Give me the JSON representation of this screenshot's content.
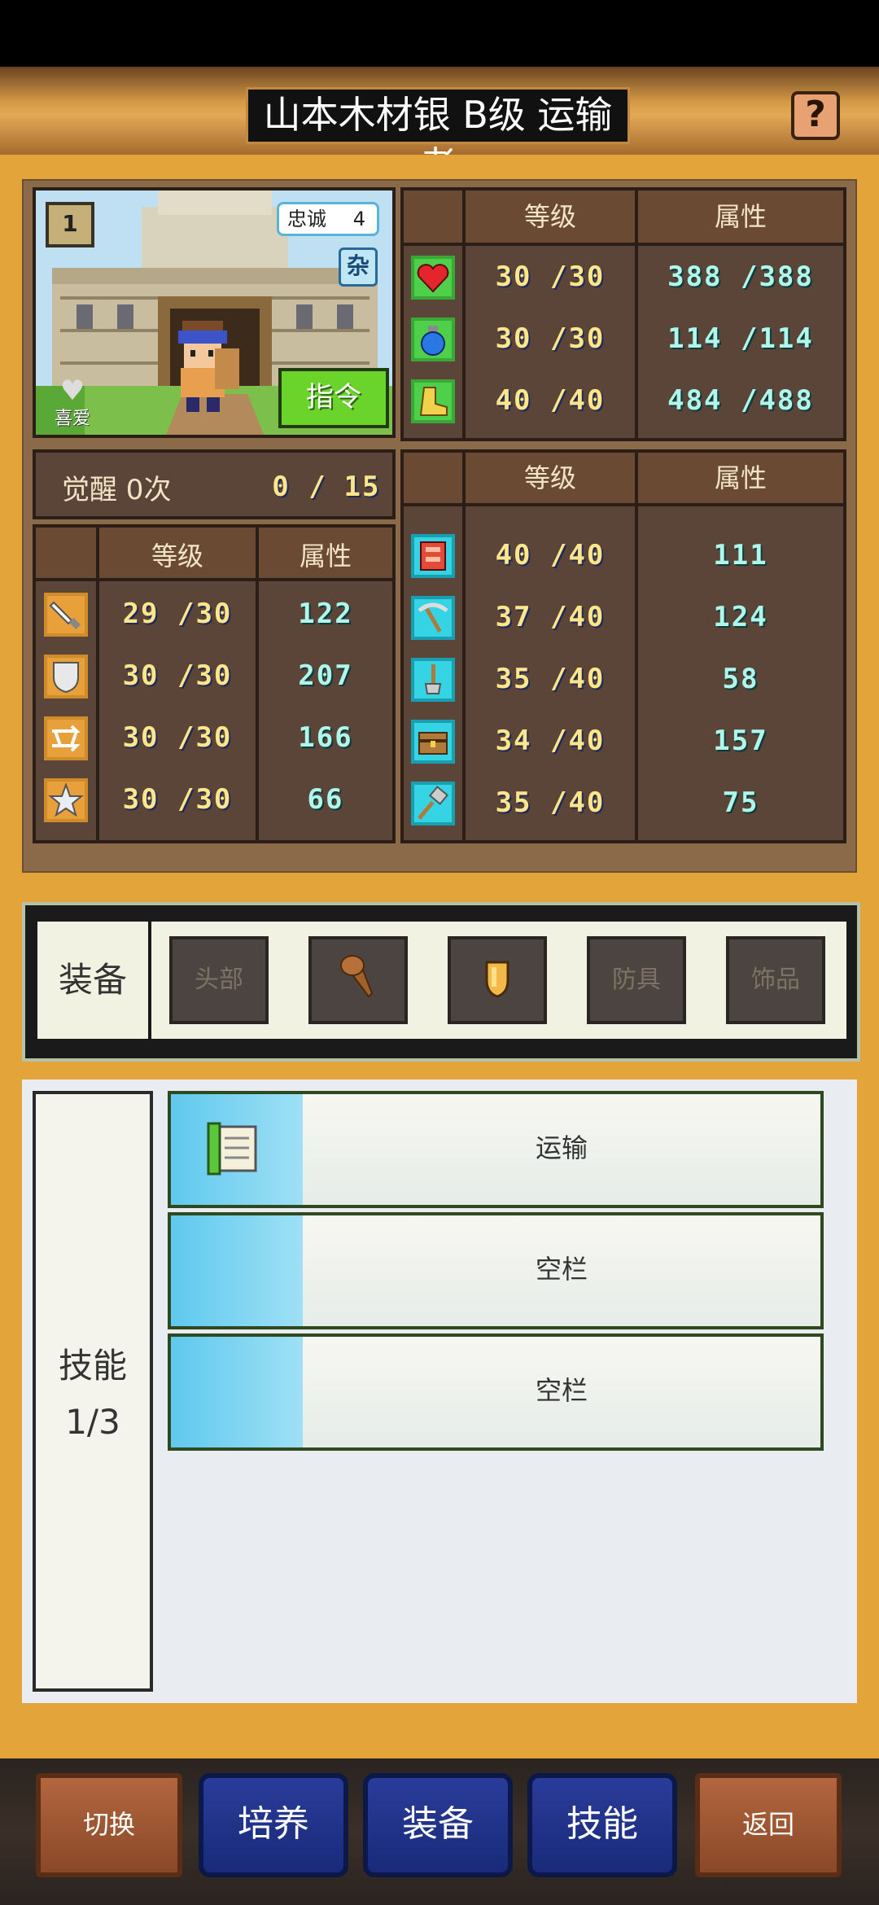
{
  "header": {
    "title": "山本木材银 B级 运输者",
    "help_icon": "?"
  },
  "portrait": {
    "loyalty_label": "忠诚",
    "loyalty_value": "4",
    "type_badge": "杂",
    "rank_badge": "1",
    "like_label": "喜爱",
    "command_button": "指令"
  },
  "upper_stats": {
    "headers": {
      "level": "等级",
      "attribute": "属性"
    },
    "rows": [
      {
        "icon": "heart-icon",
        "level": "30 /30",
        "attribute": "388 /388"
      },
      {
        "icon": "potion-icon",
        "level": "30 /30",
        "attribute": "114 /114"
      },
      {
        "icon": "boot-icon",
        "level": "40 /40",
        "attribute": "484 /488"
      }
    ]
  },
  "awakening": {
    "label": "觉醒 0次",
    "progress": "0 /",
    "max": "15"
  },
  "left_stats": {
    "headers": {
      "level": "等级",
      "attribute": "属性"
    },
    "rows": [
      {
        "icon": "sword-icon",
        "level": "29 /30",
        "attribute": "122"
      },
      {
        "icon": "shield-icon",
        "level": "30 /30",
        "attribute": "207"
      },
      {
        "icon": "arrows-icon",
        "level": "30 /30",
        "attribute": "166"
      },
      {
        "icon": "star-icon",
        "level": "30 /30",
        "attribute": "66"
      }
    ]
  },
  "right_stats": {
    "headers": {
      "level": "等级",
      "attribute": "属性"
    },
    "rows": [
      {
        "icon": "book-icon",
        "level": "40 /40",
        "attribute": "111"
      },
      {
        "icon": "pickaxe-icon",
        "level": "37 /40",
        "attribute": "124"
      },
      {
        "icon": "shovel-icon",
        "level": "35 /40",
        "attribute": "58"
      },
      {
        "icon": "chest-icon",
        "level": "34 /40",
        "attribute": "157"
      },
      {
        "icon": "hammer-icon",
        "level": "35 /40",
        "attribute": "75"
      }
    ]
  },
  "equipment": {
    "label": "装备",
    "slots": [
      {
        "label": "头部",
        "icon": ""
      },
      {
        "label": "",
        "icon": "club-icon"
      },
      {
        "label": "",
        "icon": "wooden-shield-icon"
      },
      {
        "label": "防具",
        "icon": ""
      },
      {
        "label": "饰品",
        "icon": ""
      }
    ]
  },
  "skills": {
    "label": "技能",
    "count": "1/3",
    "slots": [
      {
        "name": "运输",
        "icon": "scroll-icon"
      },
      {
        "name": "空栏",
        "icon": ""
      },
      {
        "name": "空栏",
        "icon": ""
      }
    ]
  },
  "bottom_nav": {
    "switch": "切换",
    "train": "培养",
    "equip": "装备",
    "skill": "技能",
    "back": "返回"
  },
  "colors": {
    "panel_orange": "#e3a43a",
    "dark_brown": "#5a4538",
    "level_yellow": "#ffe68a",
    "attr_cyan": "#aef7ea",
    "command_green": "#6ad42a",
    "nav_blue": "#1f3186"
  }
}
